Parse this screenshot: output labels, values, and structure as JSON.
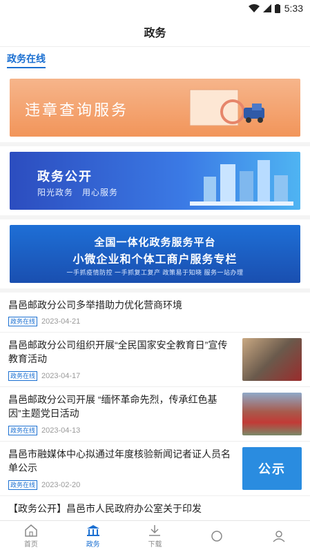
{
  "status": {
    "time": "5:33"
  },
  "header": {
    "title": "政务"
  },
  "section": {
    "title": "政务在线"
  },
  "banners": [
    {
      "text": "违章查询服务"
    },
    {
      "title": "政务公开",
      "subtitle": "阳光政务　用心服务"
    },
    {
      "line1": "全国一体化政务服务平台",
      "line2": "小微企业和个体工商户服务专栏",
      "line3": "一手抓疫情防控 一手抓复工复产 政策易于知晓 服务一站办理"
    }
  ],
  "news": [
    {
      "title": "昌邑邮政分公司多举措助力优化营商环境",
      "tag": "政务在线",
      "date": "2023-04-21"
    },
    {
      "title": "昌邑邮政分公司组织开展“全民国家安全教育日”宣传教育活动",
      "tag": "政务在线",
      "date": "2023-04-17"
    },
    {
      "title": "昌邑邮政分公司开展 “缅怀革命先烈，传承红色基因”主题党日活动",
      "tag": "政务在线",
      "date": "2023-04-13"
    },
    {
      "title": "昌邑市融媒体中心拟通过年度核验新闻记者证人员名单公示",
      "tag": "政务在线",
      "date": "2023-02-20",
      "thumb_text": "公示"
    },
    {
      "title": "【政务公开】昌邑市人民政府办公室关于印发"
    }
  ],
  "tabs": [
    {
      "label": "首页"
    },
    {
      "label": "政务"
    },
    {
      "label": "下载"
    },
    {
      "label": ""
    },
    {
      "label": ""
    }
  ],
  "colors": {
    "accent": "#1a6fd1"
  }
}
